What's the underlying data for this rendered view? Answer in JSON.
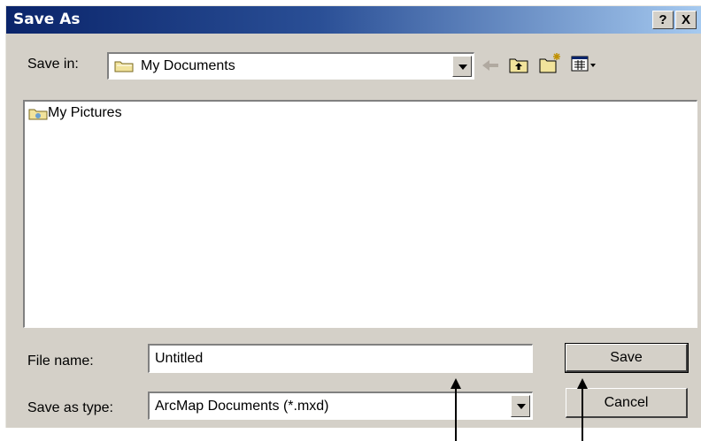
{
  "window": {
    "title": "Save As",
    "help_label": "?",
    "close_label": "X"
  },
  "toolbar": {
    "save_in_label": "Save in:",
    "location_value": "My Documents",
    "icons": [
      "back-arrow-icon",
      "up-one-level-icon",
      "new-folder-icon",
      "view-menu-icon"
    ]
  },
  "file_list": {
    "items": [
      {
        "name": "My Pictures",
        "icon": "folder-icon"
      }
    ]
  },
  "form": {
    "file_name_label": "File name:",
    "file_name_value": "Untitled",
    "save_as_type_label": "Save as type:",
    "save_as_type_value": "ArcMap Documents (*.mxd)"
  },
  "buttons": {
    "save_label": "Save",
    "cancel_label": "Cancel"
  },
  "colors": {
    "title_start": "#0a246a",
    "title_end": "#a6caf0",
    "face": "#d4d0c8"
  }
}
